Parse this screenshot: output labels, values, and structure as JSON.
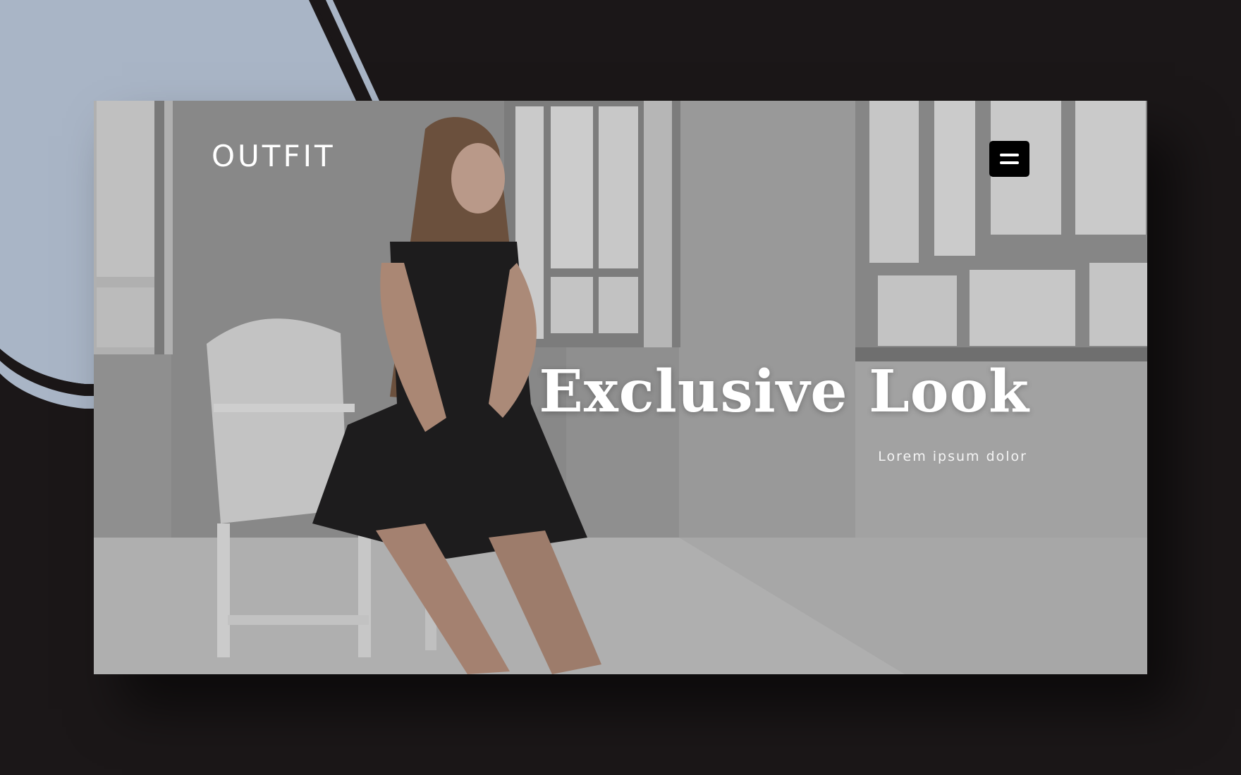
{
  "brand": {
    "logo_text": "OUTFIT"
  },
  "header": {
    "menu_icon": "hamburger-menu-icon"
  },
  "hero": {
    "title": "Exclusive Look",
    "subtitle": "Lorem ipsum dolor",
    "image_subject": "woman in black tulle dress seated on white chair by windows"
  },
  "colors": {
    "page_background": "#1b1718",
    "accent_shape": "#a9b5c6",
    "menu_button_bg": "#000000",
    "text": "#ffffff"
  }
}
